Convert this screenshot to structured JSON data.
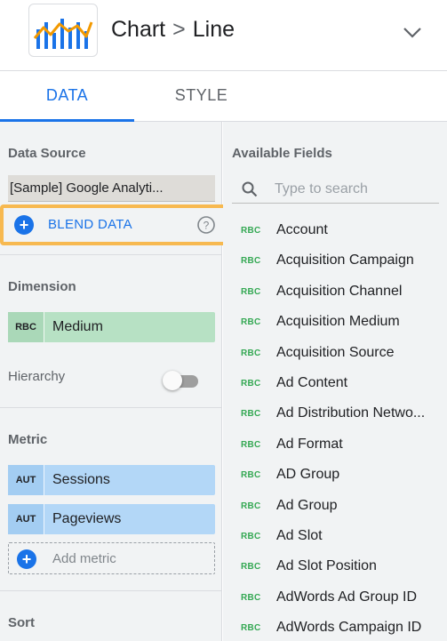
{
  "header": {
    "title_chart": "Chart",
    "title_separator": ">",
    "title_type": "Line",
    "icon": "line-chart-icon",
    "chevron_icon": "chevron-down-icon"
  },
  "tabs": [
    {
      "label": "DATA",
      "active": true
    },
    {
      "label": "STYLE",
      "active": false
    }
  ],
  "data_source": {
    "title": "Data Source",
    "value": "[Sample] Google Analyti...",
    "blend_label": "BLEND DATA",
    "blend_icon": "plus-circle-icon",
    "help_icon": "help-icon",
    "highlight_color": "#f7b950"
  },
  "dimension": {
    "title": "Dimension",
    "chips": [
      {
        "type": "RBC",
        "label": "Medium"
      }
    ],
    "hierarchy_label": "Hierarchy",
    "hierarchy_on": false
  },
  "metric": {
    "title": "Metric",
    "chips": [
      {
        "type": "AUT",
        "label": "Sessions"
      },
      {
        "type": "AUT",
        "label": "Pageviews"
      }
    ],
    "add_label": "Add metric"
  },
  "sort": {
    "title": "Sort"
  },
  "available_fields": {
    "title": "Available Fields",
    "search_placeholder": "Type to search",
    "items": [
      {
        "type": "RBC",
        "name": "Account"
      },
      {
        "type": "RBC",
        "name": "Acquisition Campaign"
      },
      {
        "type": "RBC",
        "name": "Acquisition Channel"
      },
      {
        "type": "RBC",
        "name": "Acquisition Medium"
      },
      {
        "type": "RBC",
        "name": "Acquisition Source"
      },
      {
        "type": "RBC",
        "name": "Ad Content"
      },
      {
        "type": "RBC",
        "name": "Ad Distribution Netwo..."
      },
      {
        "type": "RBC",
        "name": "Ad Format"
      },
      {
        "type": "RBC",
        "name": "AD Group"
      },
      {
        "type": "RBC",
        "name": "Ad Group"
      },
      {
        "type": "RBC",
        "name": "Ad Slot"
      },
      {
        "type": "RBC",
        "name": "Ad Slot Position"
      },
      {
        "type": "RBC",
        "name": "AdWords Ad Group ID"
      },
      {
        "type": "RBC",
        "name": "AdWords Campaign ID"
      }
    ]
  },
  "colors": {
    "accent": "#1a73e8",
    "dimension_chip": "#b7e1c4",
    "metric_chip": "#b3d7f7",
    "field_type": "#34a853"
  }
}
